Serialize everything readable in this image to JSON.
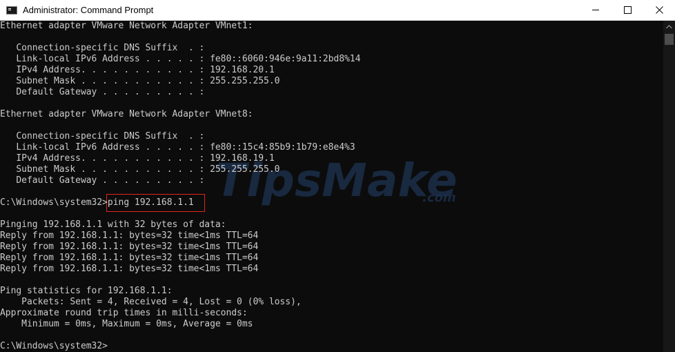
{
  "window": {
    "title": "Administrator: Command Prompt",
    "controls": {
      "minimize": "minimize",
      "maximize": "maximize",
      "close": "close"
    }
  },
  "console": {
    "lines": [
      "Ethernet adapter VMware Network Adapter VMnet1:",
      "",
      "   Connection-specific DNS Suffix  . :",
      "   Link-local IPv6 Address . . . . . : fe80::6060:946e:9a11:2bd8%14",
      "   IPv4 Address. . . . . . . . . . . : 192.168.20.1",
      "   Subnet Mask . . . . . . . . . . . : 255.255.255.0",
      "   Default Gateway . . . . . . . . . :",
      "",
      "Ethernet adapter VMware Network Adapter VMnet8:",
      "",
      "   Connection-specific DNS Suffix  . :",
      "   Link-local IPv6 Address . . . . . : fe80::15c4:85b9:1b79:e8e4%3",
      "   IPv4 Address. . . . . . . . . . . : 192.168.19.1",
      "   Subnet Mask . . . . . . . . . . . : 255.255.255.0",
      "   Default Gateway . . . . . . . . . :",
      "",
      "C:\\Windows\\system32>ping 192.168.1.1",
      "",
      "Pinging 192.168.1.1 with 32 bytes of data:",
      "Reply from 192.168.1.1: bytes=32 time<1ms TTL=64",
      "Reply from 192.168.1.1: bytes=32 time<1ms TTL=64",
      "Reply from 192.168.1.1: bytes=32 time<1ms TTL=64",
      "Reply from 192.168.1.1: bytes=32 time<1ms TTL=64",
      "",
      "Ping statistics for 192.168.1.1:",
      "    Packets: Sent = 4, Received = 4, Lost = 0 (0% loss),",
      "Approximate round trip times in milli-seconds:",
      "    Minimum = 0ms, Maximum = 0ms, Average = 0ms",
      "",
      "C:\\Windows\\system32>"
    ]
  },
  "watermark": {
    "brand": "TipsMake",
    "suffix": ".com"
  },
  "colors": {
    "console_bg": "#0c0c0c",
    "console_text": "#cccccc",
    "highlight_border": "#e0261b",
    "titlebar_bg": "#ffffff"
  }
}
